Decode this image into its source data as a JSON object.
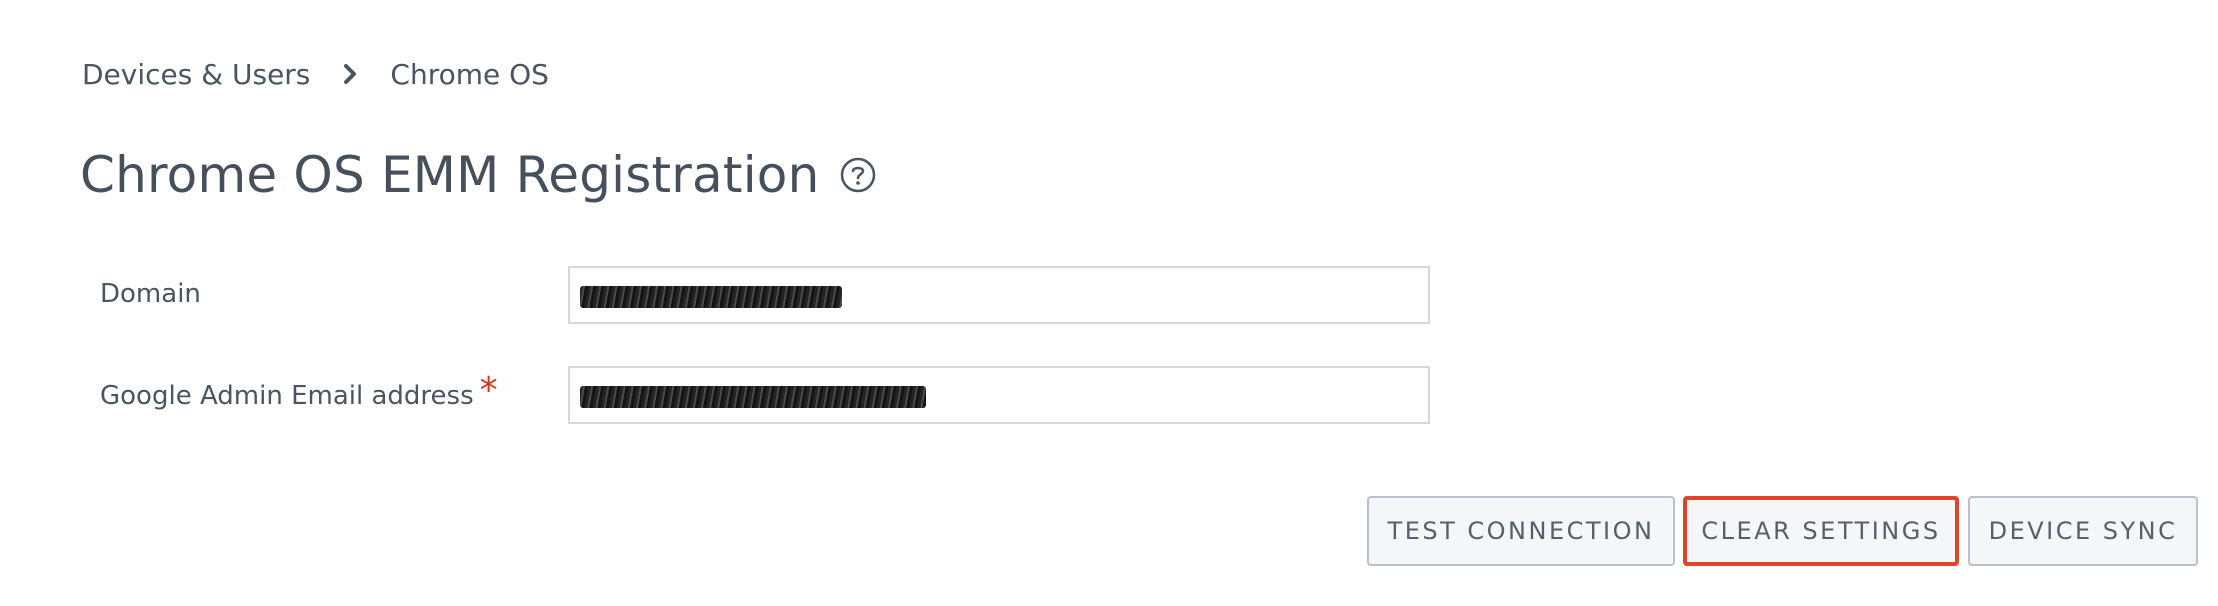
{
  "breadcrumb": {
    "items": [
      "Devices & Users",
      "Chrome OS"
    ],
    "separator_icon": "chevron-right-icon"
  },
  "header": {
    "title": "Chrome OS EMM Registration",
    "help_icon": "question-circle-icon"
  },
  "form": {
    "domain": {
      "label": "Domain",
      "value": "",
      "value_redacted": true
    },
    "admin_email": {
      "label": "Google Admin Email address",
      "required_marker": "*",
      "value": "",
      "value_redacted": true
    }
  },
  "actions": {
    "test_connection": "TEST CONNECTION",
    "clear_settings": "CLEAR SETTINGS",
    "device_sync": "DEVICE SYNC",
    "highlighted": "clear_settings"
  },
  "colors": {
    "text": "#4a5562",
    "required": "#d2391b",
    "highlight_border": "#e0452a",
    "button_bg": "#f4f6f8",
    "button_border": "#b9c1ca",
    "input_border": "#d4d8dd"
  }
}
